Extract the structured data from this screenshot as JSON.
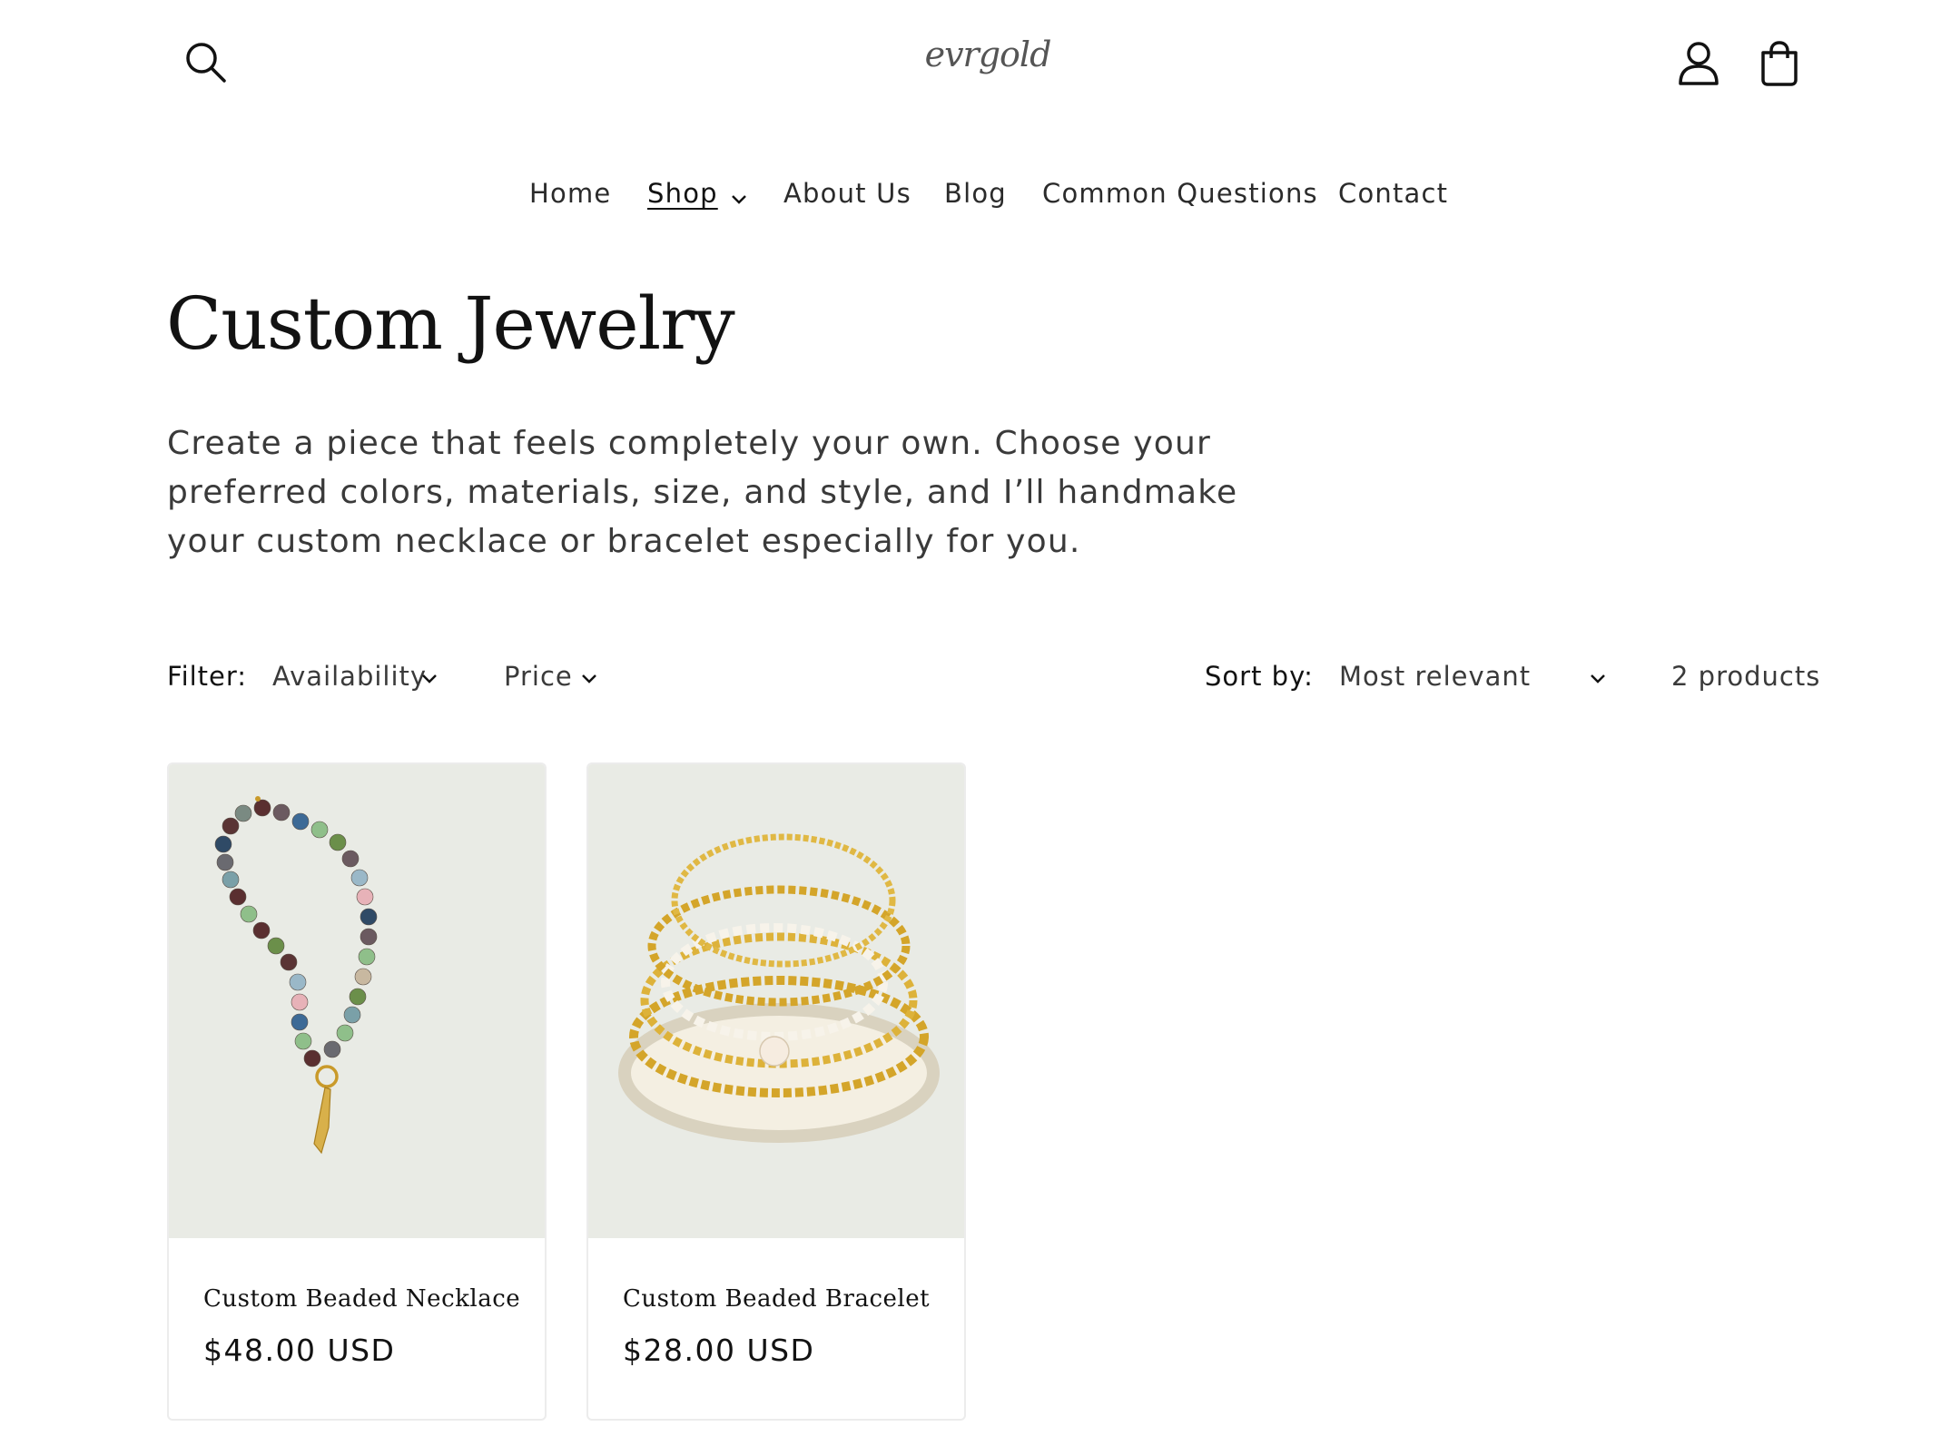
{
  "header": {
    "logo_text": "evrgold",
    "search_icon": "search-icon",
    "account_icon": "account-icon",
    "cart_icon": "cart-icon"
  },
  "nav": {
    "items": [
      {
        "label": "Home"
      },
      {
        "label": "Shop",
        "active": true,
        "has_dropdown": true
      },
      {
        "label": "About Us"
      },
      {
        "label": "Blog"
      },
      {
        "label": "Common Questions"
      },
      {
        "label": "Contact"
      }
    ]
  },
  "collection": {
    "title": "Custom Jewelry",
    "description": "Create a piece that feels completely your own. Choose your preferred colors, materials, size, and style, and I’ll handmake your custom necklace or bracelet especially for you."
  },
  "filters": {
    "label": "Filter:",
    "availability": "Availability",
    "price": "Price",
    "sort_label": "Sort by:",
    "sort_value": "Most relevant",
    "product_count": "2 products"
  },
  "products": [
    {
      "title": "Custom Beaded Necklace",
      "price": "$48.00 USD"
    },
    {
      "title": "Custom Beaded Bracelet",
      "price": "$28.00 USD"
    }
  ],
  "colors": {
    "text": "#121212",
    "muted": "#3a3a3a",
    "image_bg": "#e9ebe5",
    "gold": "#d4a52a"
  }
}
